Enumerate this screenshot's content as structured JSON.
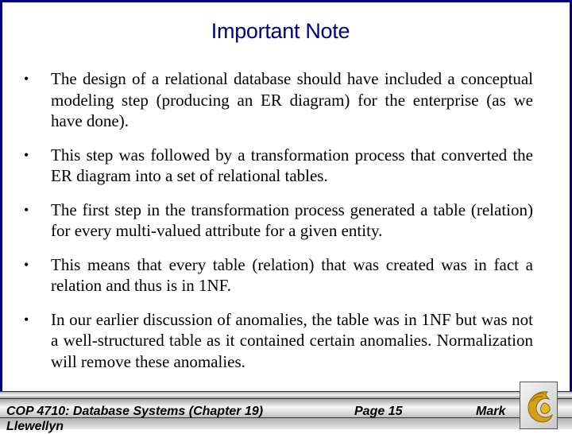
{
  "slide": {
    "title": "Important Note",
    "bullet_glyph": "•",
    "bullets": [
      "The design of a relational database should have included a conceptual modeling step (producing an ER diagram) for the enterprise (as we have done).",
      "This step was followed by a transformation process that converted the ER diagram into a set of relational tables.",
      "The first step in the transformation process generated a table (relation) for every multi-valued attribute for a given entity.",
      "This means that every table (relation) that was created was in fact a relation and thus is in 1NF.",
      "In our earlier discussion of anomalies, the table was in 1NF but was not a well-structured table as it contained certain anomalies. Normalization will remove these anomalies."
    ]
  },
  "footer": {
    "course": "COP 4710: Database Systems  (Chapter 19)",
    "page": "Page 15",
    "author_first": "Mark",
    "author_last": "Llewellyn",
    "logo": "ucf-pegasus-logo"
  },
  "colors": {
    "title": "#000080",
    "border": "#000080",
    "logo_gold": "#d4a017"
  }
}
